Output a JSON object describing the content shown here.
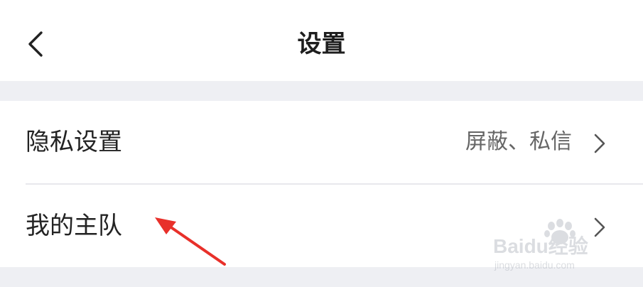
{
  "header": {
    "title": "设置",
    "back_icon": "chevron-left-icon"
  },
  "settings": {
    "rows": [
      {
        "label": "隐私设置",
        "value": "屏蔽、私信",
        "icon": "chevron-right-icon"
      },
      {
        "label": "我的主队",
        "value": "",
        "icon": "chevron-right-icon"
      }
    ]
  },
  "annotation": {
    "arrow_color": "#e8302a"
  },
  "watermark": {
    "text": "Baidu经验",
    "subtext": "jingyan.baidu.com"
  },
  "colors": {
    "background": "#eeeff3",
    "surface": "#ffffff",
    "divider": "#e8e8ec",
    "text_primary": "#232323",
    "text_secondary": "#666666"
  }
}
